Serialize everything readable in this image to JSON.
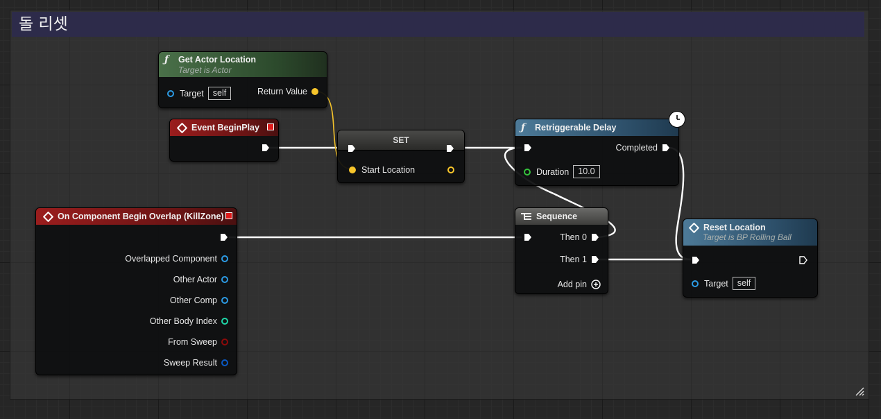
{
  "comment": {
    "title": "돌 리셋"
  },
  "nodes": {
    "get_actor_location": {
      "title": "Get Actor Location",
      "subtitle": "Target is Actor",
      "target_label": "Target",
      "target_value": "self",
      "return_label": "Return Value"
    },
    "event_beginplay": {
      "title": "Event BeginPlay"
    },
    "set": {
      "title": "SET",
      "pin_label": "Start Location"
    },
    "retriggerable_delay": {
      "title": "Retriggerable Delay",
      "completed_label": "Completed",
      "duration_label": "Duration",
      "duration_value": "10.0"
    },
    "begin_overlap": {
      "title": "On Component Begin Overlap (KillZone)",
      "pins": [
        "Overlapped Component",
        "Other Actor",
        "Other Comp",
        "Other Body Index",
        "From Sweep",
        "Sweep Result"
      ]
    },
    "sequence": {
      "title": "Sequence",
      "then0": "Then 0",
      "then1": "Then 1",
      "add_pin": "Add pin"
    },
    "reset_location": {
      "title": "Reset Location",
      "subtitle": "Target is BP Rolling Ball",
      "target_label": "Target",
      "target_value": "self"
    }
  },
  "colors": {
    "vector_pin": "#f7c52b",
    "object_pin": "#2c9be5",
    "int_pin": "#1ed6a8",
    "float_pin": "#35c23c",
    "bool_pin": "#8c0a0a",
    "struct_pin": "#0a59c4",
    "function_header": "#2f5a32",
    "event_header": "#8c1818",
    "call_header": "#365a79"
  },
  "icons": [
    "function-icon",
    "event-icon",
    "sequence-icon",
    "clock-icon",
    "exec-pin-icon",
    "add-pin-icon"
  ]
}
